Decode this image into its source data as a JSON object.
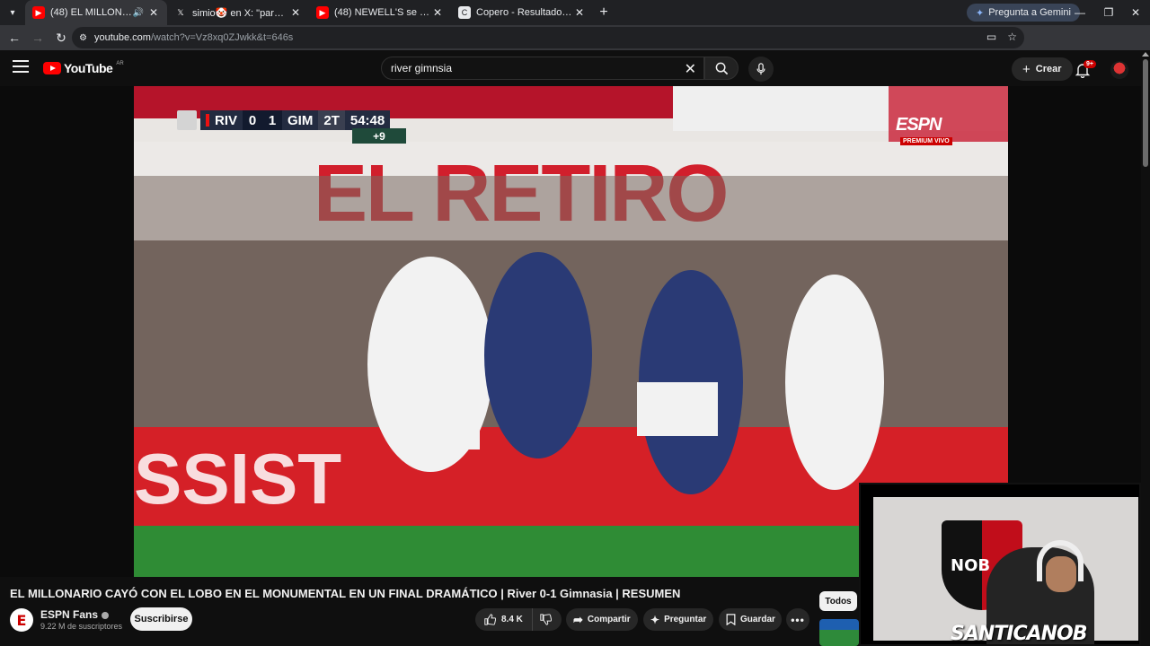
{
  "browser": {
    "tabs": [
      {
        "title": "(48) EL MILLONARIO CAYÓ",
        "active": true,
        "favicon": "youtube-icon"
      },
      {
        "title": "simio🤡 en X: \"para vieja re ex",
        "active": false,
        "favicon": "x-icon"
      },
      {
        "title": "(48) NEWELL'S se acercó a la Pl",
        "active": false,
        "favicon": "youtube-icon"
      },
      {
        "title": "Copero - Resultados, estadístic",
        "active": false,
        "favicon": "copero-icon"
      }
    ],
    "gemini_label": "Pregunta a Gemini",
    "url_host": "youtube.com",
    "url_path": "/watch?v=Vz8xq0ZJwkk&t=646s"
  },
  "youtube": {
    "logo_text": "YouTube",
    "country_code": "AR",
    "search_value": "river gimnsia",
    "create_label": "Crear",
    "notifications_badge": "9+"
  },
  "video": {
    "scoreboard": {
      "home": "RIV",
      "home_score": "0",
      "away_score": "1",
      "away": "GIM",
      "half": "2T",
      "clock": "54:48",
      "added": "+9"
    },
    "broadcaster": "ESPN",
    "broadcaster_sub": "PREMIUM VIVO",
    "overlay_name": "SANTICANOB",
    "overlay_flag_text": "NOB"
  },
  "details": {
    "title": "EL MILLONARIO CAYÓ CON EL LOBO EN EL MONUMENTAL EN UN FINAL DRAMÁTICO | River 0-1 Gimnasia | RESUMEN",
    "channel_name": "ESPN Fans",
    "subscribers": "9.22 M de suscriptores",
    "subscribe_label": "Suscribirse",
    "likes": "8.4 K",
    "share_label": "Compartir",
    "ask_label": "Preguntar",
    "save_label": "Guardar",
    "chip_all": "Todos"
  },
  "colors": {
    "youtube_red": "#ff0000",
    "bg": "#0f0f0f",
    "pill": "#272727",
    "tab_active": "#35363a"
  }
}
